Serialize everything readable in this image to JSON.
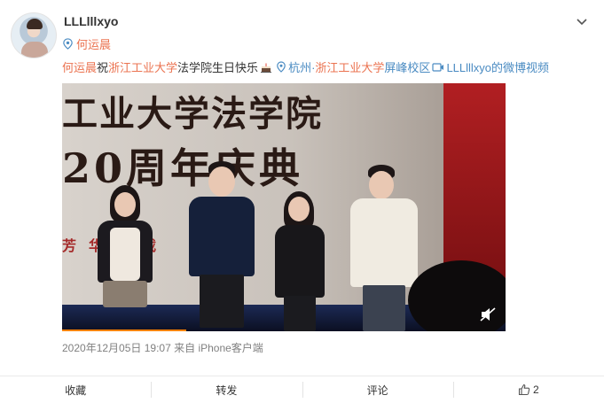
{
  "post": {
    "username": "LLLlllxyo",
    "tag": "何运晨",
    "content": {
      "mention": "何运晨",
      "text1": "祝",
      "school": "浙江工业大学",
      "text2": "法学院生日快乐",
      "location_prefix": "杭州·",
      "location_school": "浙江工业大学",
      "location_suffix": "屏峰校区",
      "video_link": "LLLlllxyo的微博视频"
    },
    "video": {
      "banner_line1": "工业大学法学院",
      "banner_line2": "20周年庆典",
      "banner_line3": "芳华盈载",
      "progress_fraction": 0.28
    },
    "meta": {
      "datetime": "2020年12月05日 19:07",
      "source": "来自 iPhone客户端"
    }
  },
  "toolbar": {
    "favorite": "收藏",
    "repost": "转发",
    "comment": "评论",
    "like_count": "2"
  },
  "colors": {
    "link": "#eb7350",
    "blue_link": "#4a8bc2",
    "progress": "#ff8200"
  }
}
